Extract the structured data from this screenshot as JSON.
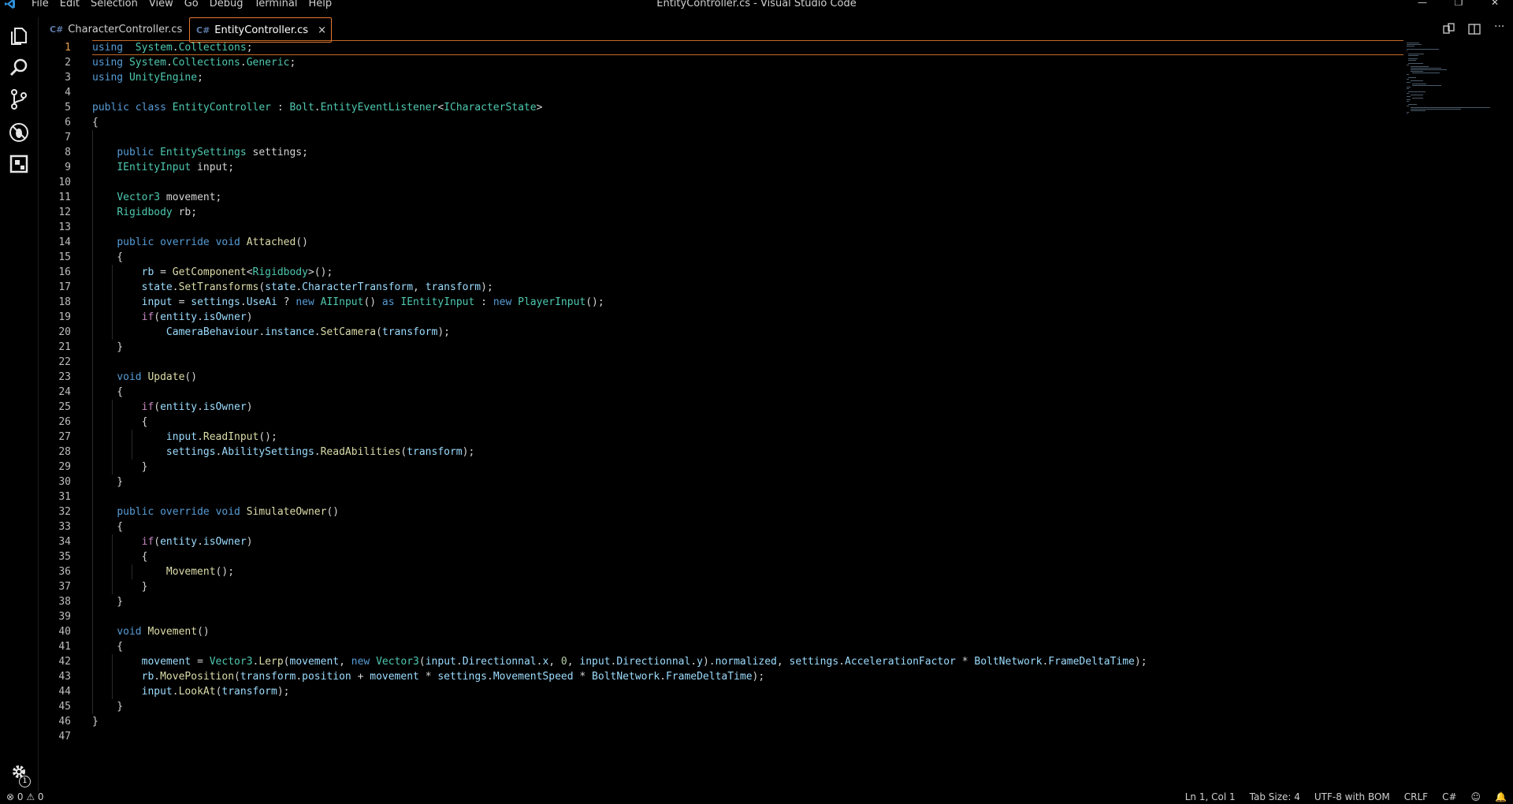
{
  "window": {
    "title": "EntityController.cs - Visual Studio Code"
  },
  "menu": [
    "File",
    "Edit",
    "Selection",
    "View",
    "Go",
    "Debug",
    "Terminal",
    "Help"
  ],
  "tabs": [
    {
      "label": "CharacterController.cs",
      "active": false
    },
    {
      "label": "EntityController.cs",
      "active": true
    }
  ],
  "tab_close": "×",
  "icons": {
    "tab_file": "C#",
    "activity": [
      "explorer-icon",
      "search-icon",
      "source-control-icon",
      "debug-icon",
      "extensions-icon",
      "gear-icon"
    ],
    "topright": [
      "compare-icon",
      "split-editor-icon",
      "more-icon"
    ]
  },
  "activity_badge": "1",
  "editor": {
    "current_line": 1,
    "lines": [
      "1",
      "2",
      "3",
      "4",
      "5",
      "6",
      "7",
      "8",
      "9",
      "10",
      "11",
      "12",
      "13",
      "14",
      "15",
      "16",
      "17",
      "18",
      "19",
      "20",
      "21",
      "22",
      "23",
      "24",
      "25",
      "26",
      "27",
      "28",
      "29",
      "30",
      "31",
      "32",
      "33",
      "34",
      "35",
      "36",
      "37",
      "38",
      "39",
      "40",
      "41",
      "42",
      "43",
      "44",
      "45",
      "46",
      "47"
    ],
    "code": [
      [
        [
          "kw",
          "using"
        ],
        [
          "",
          "  "
        ],
        [
          "ty",
          "System"
        ],
        [
          "",
          "."
        ],
        [
          "ty",
          "Collections"
        ],
        [
          "",
          ";"
        ]
      ],
      [
        [
          "kw",
          "using"
        ],
        [
          "",
          ""
        ],
        [
          "ty",
          "System"
        ],
        [
          "",
          "."
        ],
        [
          "ty",
          "Collections"
        ],
        [
          "",
          "."
        ],
        [
          "ty",
          "Generic"
        ],
        [
          "",
          ";"
        ]
      ],
      [
        [
          "kw",
          "using"
        ],
        [
          "",
          ""
        ],
        [
          "ty",
          "UnityEngine"
        ],
        [
          "",
          ";"
        ]
      ],
      [],
      [
        [
          "kw",
          "public"
        ],
        [
          "",
          ""
        ],
        [
          "kw",
          "class"
        ],
        [
          "",
          ""
        ],
        [
          "ty",
          "EntityController"
        ],
        [
          "",
          ":"
        ],
        [
          "ty",
          "Bolt"
        ],
        [
          "",
          "."
        ],
        [
          "ty",
          "EntityEventListener"
        ],
        [
          "",
          "<"
        ],
        [
          "ty",
          "ICharacterState"
        ],
        [
          "",
          ">"
        ]
      ],
      [
        [
          "",
          "{"
        ]
      ],
      [],
      [
        [
          "",
          "    "
        ],
        [
          "kw",
          "public"
        ],
        [
          "",
          ""
        ],
        [
          "ty",
          "EntitySettings"
        ],
        [
          "",
          "settings;"
        ]
      ],
      [
        [
          "",
          "    "
        ],
        [
          "ty",
          "IEntityInput"
        ],
        [
          "",
          "input;"
        ]
      ],
      [],
      [
        [
          "",
          "    "
        ],
        [
          "ty",
          "Vector3"
        ],
        [
          "",
          "movement;"
        ]
      ],
      [
        [
          "",
          "    "
        ],
        [
          "ty",
          "Rigidbody"
        ],
        [
          "",
          "rb;"
        ]
      ],
      [],
      [
        [
          "",
          "    "
        ],
        [
          "kw",
          "public"
        ],
        [
          "",
          ""
        ],
        [
          "kw",
          "override"
        ],
        [
          "",
          ""
        ],
        [
          "kw",
          "void"
        ],
        [
          "",
          ""
        ],
        [
          "fn",
          "Attached"
        ],
        [
          "",
          "()"
        ]
      ],
      [
        [
          "",
          "    {"
        ]
      ],
      [
        [
          "",
          "        "
        ],
        [
          "vr",
          "rb"
        ],
        [
          "",
          "= "
        ],
        [
          "fn",
          "GetComponent"
        ],
        [
          "",
          "<"
        ],
        [
          "ty",
          "Rigidbody"
        ],
        [
          "",
          ">();"
        ]
      ],
      [
        [
          "",
          "        "
        ],
        [
          "vr",
          "state"
        ],
        [
          "",
          "."
        ],
        [
          "fn",
          "SetTransforms"
        ],
        [
          "",
          "("
        ],
        [
          "vr",
          "state"
        ],
        [
          "",
          "."
        ],
        [
          "vr",
          "CharacterTransform"
        ],
        [
          "",
          ", "
        ],
        [
          "vr",
          "transform"
        ],
        [
          "",
          ");"
        ]
      ],
      [
        [
          "",
          "        "
        ],
        [
          "vr",
          "input"
        ],
        [
          "",
          "= "
        ],
        [
          "vr",
          "settings"
        ],
        [
          "",
          "."
        ],
        [
          "vr",
          "UseAi"
        ],
        [
          "",
          "? "
        ],
        [
          "kw",
          "new"
        ],
        [
          "",
          ""
        ],
        [
          "ty",
          "AIInput"
        ],
        [
          "",
          "() "
        ],
        [
          "kw",
          "as"
        ],
        [
          "",
          ""
        ],
        [
          "ty",
          "IEntityInput"
        ],
        [
          "",
          ": "
        ],
        [
          "kw",
          "new"
        ],
        [
          "",
          ""
        ],
        [
          "ty",
          "PlayerInput"
        ],
        [
          "",
          "();"
        ]
      ],
      [
        [
          "",
          "        "
        ],
        [
          "kw2",
          "if"
        ],
        [
          "",
          "("
        ],
        [
          "vr",
          "entity"
        ],
        [
          "",
          "."
        ],
        [
          "vr",
          "isOwner"
        ],
        [
          "",
          ")"
        ]
      ],
      [
        [
          "",
          "            "
        ],
        [
          "vr",
          "CameraBehaviour"
        ],
        [
          "",
          "."
        ],
        [
          "vr",
          "instance"
        ],
        [
          "",
          "."
        ],
        [
          "fn",
          "SetCamera"
        ],
        [
          "",
          "("
        ],
        [
          "vr",
          "transform"
        ],
        [
          "",
          ");"
        ]
      ],
      [
        [
          "",
          "    }"
        ]
      ],
      [],
      [
        [
          "",
          "    "
        ],
        [
          "kw",
          "void"
        ],
        [
          "",
          ""
        ],
        [
          "fn",
          "Update"
        ],
        [
          "",
          "()"
        ]
      ],
      [
        [
          "",
          "    {"
        ]
      ],
      [
        [
          "",
          "        "
        ],
        [
          "kw2",
          "if"
        ],
        [
          "",
          "("
        ],
        [
          "vr",
          "entity"
        ],
        [
          "",
          "."
        ],
        [
          "vr",
          "isOwner"
        ],
        [
          "",
          ")"
        ]
      ],
      [
        [
          "",
          "        {"
        ]
      ],
      [
        [
          "",
          "            "
        ],
        [
          "vr",
          "input"
        ],
        [
          "",
          "."
        ],
        [
          "fn",
          "ReadInput"
        ],
        [
          "",
          "();"
        ]
      ],
      [
        [
          "",
          "            "
        ],
        [
          "vr",
          "settings"
        ],
        [
          "",
          "."
        ],
        [
          "vr",
          "AbilitySettings"
        ],
        [
          "",
          "."
        ],
        [
          "fn",
          "ReadAbilities"
        ],
        [
          "",
          "("
        ],
        [
          "vr",
          "transform"
        ],
        [
          "",
          ");"
        ]
      ],
      [
        [
          "",
          "        }"
        ]
      ],
      [
        [
          "",
          "    }"
        ]
      ],
      [],
      [
        [
          "",
          "    "
        ],
        [
          "kw",
          "public"
        ],
        [
          "",
          ""
        ],
        [
          "kw",
          "override"
        ],
        [
          "",
          ""
        ],
        [
          "kw",
          "void"
        ],
        [
          "",
          ""
        ],
        [
          "fn",
          "SimulateOwner"
        ],
        [
          "",
          "()"
        ]
      ],
      [
        [
          "",
          "    {"
        ]
      ],
      [
        [
          "",
          "        "
        ],
        [
          "kw2",
          "if"
        ],
        [
          "",
          "("
        ],
        [
          "vr",
          "entity"
        ],
        [
          "",
          "."
        ],
        [
          "vr",
          "isOwner"
        ],
        [
          "",
          ")"
        ]
      ],
      [
        [
          "",
          "        {"
        ]
      ],
      [
        [
          "",
          "            "
        ],
        [
          "fn",
          "Movement"
        ],
        [
          "",
          "();"
        ]
      ],
      [
        [
          "",
          "        }"
        ]
      ],
      [
        [
          "",
          "    }"
        ]
      ],
      [],
      [
        [
          "",
          "    "
        ],
        [
          "kw",
          "void"
        ],
        [
          "",
          ""
        ],
        [
          "fn",
          "Movement"
        ],
        [
          "",
          "()"
        ]
      ],
      [
        [
          "",
          "    {"
        ]
      ],
      [
        [
          "",
          "        "
        ],
        [
          "vr",
          "movement"
        ],
        [
          "",
          "= "
        ],
        [
          "ty",
          "Vector3"
        ],
        [
          "",
          "."
        ],
        [
          "fn",
          "Lerp"
        ],
        [
          "",
          "("
        ],
        [
          "vr",
          "movement"
        ],
        [
          "",
          ", "
        ],
        [
          "kw",
          "new"
        ],
        [
          "",
          ""
        ],
        [
          "ty",
          "Vector3"
        ],
        [
          "",
          "("
        ],
        [
          "vr",
          "input"
        ],
        [
          "",
          "."
        ],
        [
          "vr",
          "Directionnal"
        ],
        [
          "",
          "."
        ],
        [
          "vr",
          "x"
        ],
        [
          "",
          ", "
        ],
        [
          "num",
          "0"
        ],
        [
          "",
          ", "
        ],
        [
          "vr",
          "input"
        ],
        [
          "",
          "."
        ],
        [
          "vr",
          "Directionnal"
        ],
        [
          "",
          "."
        ],
        [
          "vr",
          "y"
        ],
        [
          "",
          ")."
        ],
        [
          "vr",
          "normalized"
        ],
        [
          "",
          ", "
        ],
        [
          "vr",
          "settings"
        ],
        [
          "",
          "."
        ],
        [
          "vr",
          "AccelerationFactor"
        ],
        [
          "",
          "* "
        ],
        [
          "vr",
          "BoltNetwork"
        ],
        [
          "",
          "."
        ],
        [
          "vr",
          "FrameDeltaTime"
        ],
        [
          "",
          ");"
        ]
      ],
      [
        [
          "",
          "        "
        ],
        [
          "vr",
          "rb"
        ],
        [
          "",
          "."
        ],
        [
          "fn",
          "MovePosition"
        ],
        [
          "",
          "("
        ],
        [
          "vr",
          "transform"
        ],
        [
          "",
          "."
        ],
        [
          "vr",
          "position"
        ],
        [
          "",
          "+ "
        ],
        [
          "vr",
          "movement"
        ],
        [
          "",
          "* "
        ],
        [
          "vr",
          "settings"
        ],
        [
          "",
          "."
        ],
        [
          "vr",
          "MovementSpeed"
        ],
        [
          "",
          "* "
        ],
        [
          "vr",
          "BoltNetwork"
        ],
        [
          "",
          "."
        ],
        [
          "vr",
          "FrameDeltaTime"
        ],
        [
          "",
          ");"
        ]
      ],
      [
        [
          "",
          "        "
        ],
        [
          "vr",
          "input"
        ],
        [
          "",
          "."
        ],
        [
          "fn",
          "LookAt"
        ],
        [
          "",
          "("
        ],
        [
          "vr",
          "transform"
        ],
        [
          "",
          ");"
        ]
      ],
      [
        [
          "",
          "    }"
        ]
      ],
      [
        [
          "",
          "}"
        ]
      ],
      []
    ]
  },
  "status": {
    "left": "⊗ 0  ⚠ 0",
    "right": [
      "Ln 1, Col 1",
      "Tab Size: 4",
      "UTF-8 with BOM",
      "CRLF",
      "C#"
    ]
  }
}
